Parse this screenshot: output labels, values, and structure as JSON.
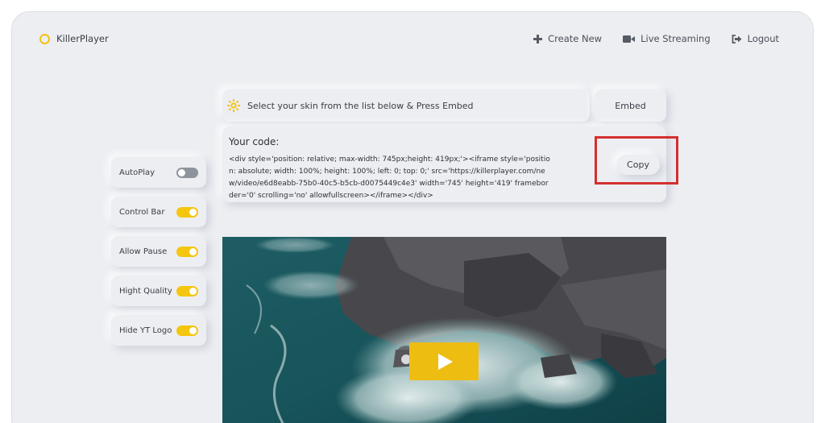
{
  "header": {
    "logo_text": "KillerPlayer",
    "nav": [
      {
        "label": "Create New",
        "icon": "plus-icon"
      },
      {
        "label": "Live Streaming",
        "icon": "video-camera-icon"
      },
      {
        "label": "Logout",
        "icon": "logout-icon"
      }
    ]
  },
  "skin": {
    "instruction": "Select your skin from the list below & Press Embed",
    "embed_label": "Embed"
  },
  "code": {
    "title": "Your code:",
    "snippet": "<div style='position: relative; max-width: 745px;height: 419px;'><iframe style='position: absolute; width: 100%; height: 100%; left: 0; top: 0;' src='https://killerplayer.com/new/video/e6d8eabb-75b0-40c5-b5cb-d0075449c4e3' width='745' height='419' frameborder='0' scrolling='no' allowfullscreen></iframe></div>",
    "copy_label": "Copy"
  },
  "toggles": [
    {
      "label": "AutoPlay",
      "on": false
    },
    {
      "label": "Control Bar",
      "on": true
    },
    {
      "label": "Allow Pause",
      "on": true
    },
    {
      "label": "Hight Quality",
      "on": true
    },
    {
      "label": "Hide YT Logo",
      "on": true
    }
  ],
  "colors": {
    "accent": "#f4c60e",
    "highlight": "#d42f2f",
    "background": "#eceef2"
  }
}
